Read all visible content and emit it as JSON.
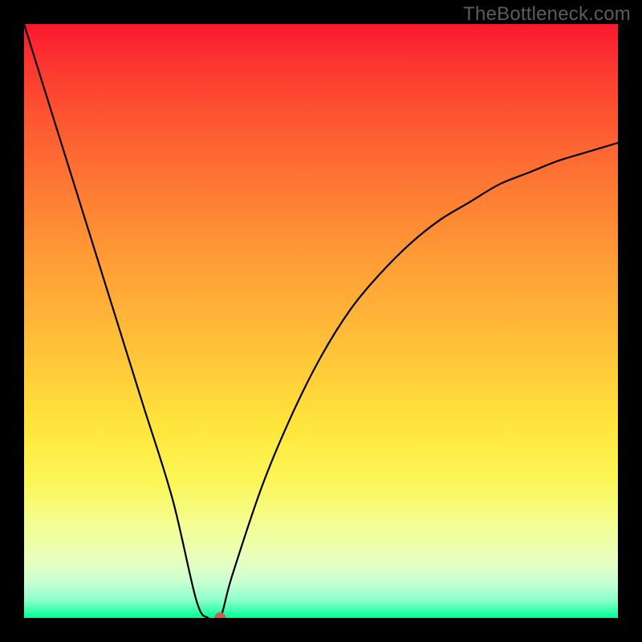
{
  "watermark": "TheBottleneck.com",
  "chart_data": {
    "type": "line",
    "title": "",
    "xlabel": "",
    "ylabel": "",
    "xlim": [
      0,
      100
    ],
    "ylim": [
      0,
      100
    ],
    "series": [
      {
        "name": "bottleneck-curve",
        "x": [
          0,
          5,
          10,
          15,
          20,
          25,
          29,
          31,
          33,
          35,
          40,
          45,
          50,
          55,
          60,
          65,
          70,
          75,
          80,
          85,
          90,
          95,
          100
        ],
        "values": [
          100,
          84,
          68,
          52,
          36,
          20,
          3,
          0,
          0,
          7,
          22,
          34,
          44,
          52,
          58,
          63,
          67,
          70,
          73,
          75,
          77,
          78.5,
          80
        ]
      }
    ],
    "marker": {
      "x": 33,
      "y": 0,
      "color": "#d65a54"
    },
    "gradient_stops": [
      {
        "pos": 0,
        "color": "#fb1730"
      },
      {
        "pos": 6,
        "color": "#fc3330"
      },
      {
        "pos": 15,
        "color": "#fd5331"
      },
      {
        "pos": 27,
        "color": "#fe7833"
      },
      {
        "pos": 40,
        "color": "#ff9d36"
      },
      {
        "pos": 55,
        "color": "#ffc339"
      },
      {
        "pos": 68,
        "color": "#ffe63c"
      },
      {
        "pos": 77,
        "color": "#fbf658"
      },
      {
        "pos": 84,
        "color": "#f4fd90"
      },
      {
        "pos": 90,
        "color": "#e9ffbd"
      },
      {
        "pos": 94,
        "color": "#c8ffd3"
      },
      {
        "pos": 97,
        "color": "#8affca"
      },
      {
        "pos": 100,
        "color": "#00ff95"
      }
    ]
  }
}
